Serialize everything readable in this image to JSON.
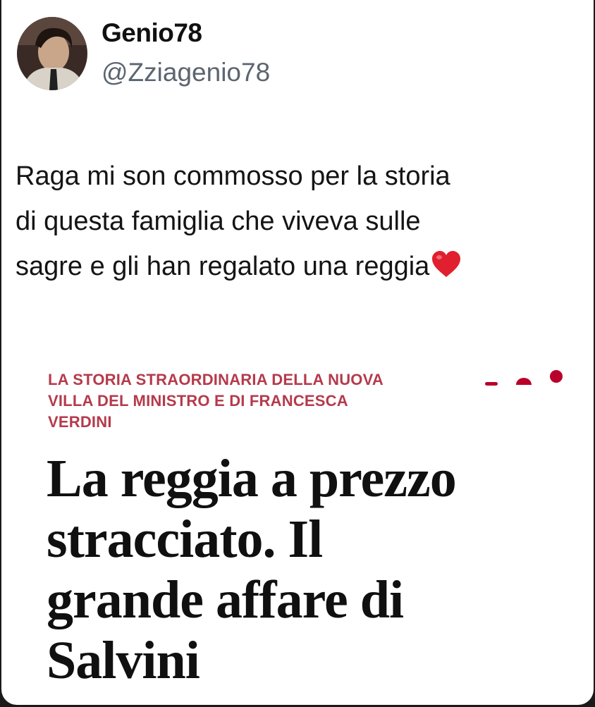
{
  "tweet": {
    "display_name": "Genio78",
    "handle": "@Zziagenio78",
    "text_lines": [
      "Raga mi son commosso per la storia",
      "di questa famiglia che viveva sulle",
      "sagre e gli han regalato una reggia"
    ],
    "emoji": "red-heart-icon"
  },
  "article": {
    "tag_lines": [
      "LA STORIA STRAORDINARIA DELLA NUOVA",
      "VILLA DEL MINISTRO E DI FRANCESCA",
      "VERDINI"
    ],
    "headline_lines": [
      "La reggia a prezzo",
      "stracciato. Il",
      "grande affare di",
      "Salvini"
    ],
    "accent_color": "#b53a4c"
  }
}
